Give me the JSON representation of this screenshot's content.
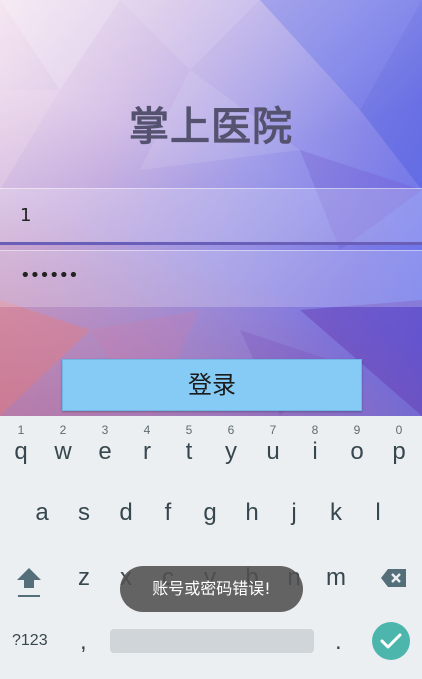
{
  "app": {
    "title": "掌上医院",
    "username_value": "1",
    "password_value": "••••••",
    "login_label": "登录"
  },
  "keyboard": {
    "row1": [
      {
        "hint": "1",
        "ch": "q"
      },
      {
        "hint": "2",
        "ch": "w"
      },
      {
        "hint": "3",
        "ch": "e"
      },
      {
        "hint": "4",
        "ch": "r"
      },
      {
        "hint": "5",
        "ch": "t"
      },
      {
        "hint": "6",
        "ch": "y"
      },
      {
        "hint": "7",
        "ch": "u"
      },
      {
        "hint": "8",
        "ch": "i"
      },
      {
        "hint": "9",
        "ch": "o"
      },
      {
        "hint": "0",
        "ch": "p"
      }
    ],
    "row2": [
      "a",
      "s",
      "d",
      "f",
      "g",
      "h",
      "j",
      "k",
      "l"
    ],
    "row3": [
      "z",
      "x",
      "c",
      "v",
      "b",
      "n",
      "m"
    ],
    "symbols_label": "?123",
    "comma_label": ",",
    "period_label": ".",
    "shift_icon": "shift-icon",
    "backspace_icon": "backspace-icon",
    "enter_icon": "check-icon"
  },
  "toast": {
    "message": "账号或密码错误!"
  },
  "colors": {
    "login_button": "#86cbf6",
    "title_text": "#555270",
    "enter_key": "#4db6ac",
    "toast_bg": "#505050"
  }
}
